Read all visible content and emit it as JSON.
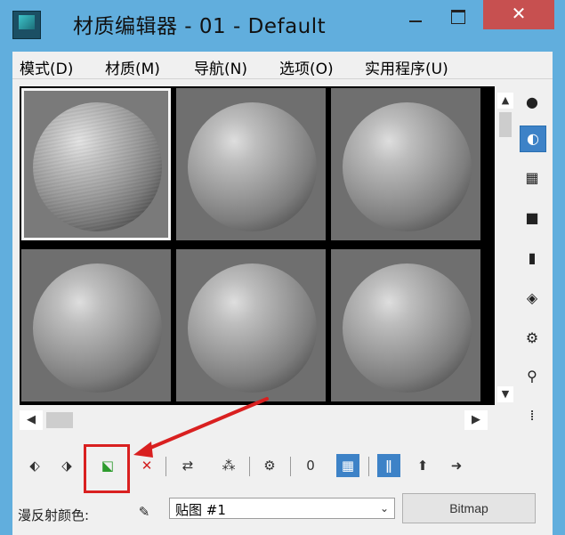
{
  "window": {
    "title": "材质编辑器 - 01 - Default",
    "close_glyph": "✕"
  },
  "menu": {
    "items": [
      "模式(D)",
      "材质(M)",
      "导航(N)",
      "选项(O)",
      "实用程序(U)"
    ]
  },
  "scroll": {
    "up": "▲",
    "down": "▼",
    "left": "◀",
    "right": "▶"
  },
  "side_tools": [
    {
      "icon": "sample-type-sphere-icon",
      "glyph": "●"
    },
    {
      "icon": "backlight-icon",
      "glyph": "◐"
    },
    {
      "icon": "background-checker-icon",
      "glyph": "▦"
    },
    {
      "icon": "sample-uv-tiling-icon",
      "glyph": "■"
    },
    {
      "icon": "video-color-check-icon",
      "glyph": "▮"
    },
    {
      "icon": "make-preview-icon",
      "glyph": "◈"
    },
    {
      "icon": "options-icon",
      "glyph": "⚙"
    },
    {
      "icon": "select-by-material-icon",
      "glyph": "⚲"
    },
    {
      "icon": "material-map-navigator-icon",
      "glyph": "⁞"
    }
  ],
  "bottom_tools": [
    {
      "icon": "get-material-icon",
      "glyph": "⬖"
    },
    {
      "icon": "put-material-to-scene-icon",
      "glyph": "⬗"
    },
    {
      "icon": "assign-material-to-selection-icon",
      "glyph": "⬕"
    },
    {
      "icon": "reset-map-icon",
      "glyph": "✕"
    },
    {
      "icon": "make-material-copy-icon",
      "glyph": "⇄"
    },
    {
      "icon": "make-unique-icon",
      "glyph": "⁂"
    },
    {
      "icon": "put-to-library-icon",
      "glyph": "⚙"
    },
    {
      "icon": "material-id-channel-icon",
      "glyph": "0"
    },
    {
      "icon": "show-shaded-material-icon",
      "glyph": "▦"
    },
    {
      "icon": "show-end-result-icon",
      "glyph": "ǁ"
    },
    {
      "icon": "go-to-parent-icon",
      "glyph": "⬆"
    },
    {
      "icon": "go-forward-to-sibling-icon",
      "glyph": "➜"
    }
  ],
  "params": {
    "diffuse_label": "漫反射颜色:",
    "map_name": "贴图 #1",
    "map_type": "Bitmap",
    "eyedropper_glyph": "✎",
    "dropdown_glyph": "⌄"
  },
  "colors": {
    "title_bar": "#61aedd",
    "close_button": "#c75050",
    "selected_tool": "#3d82c7",
    "annotation_red": "#d92020"
  }
}
